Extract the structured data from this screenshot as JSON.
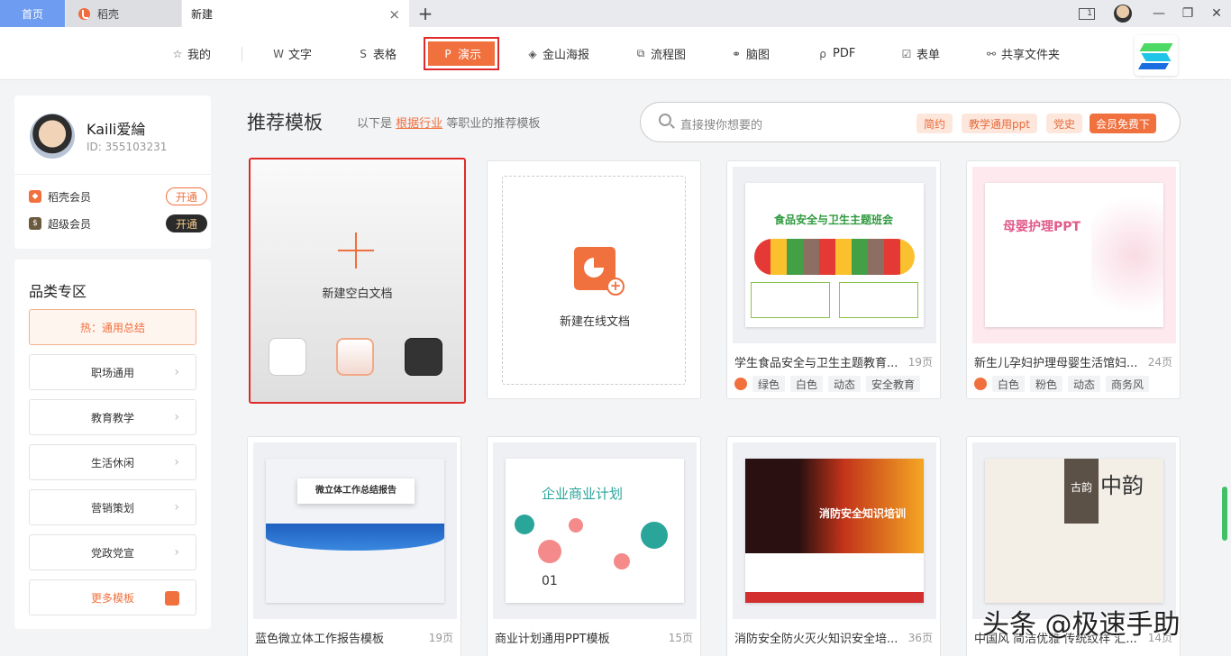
{
  "tabs": {
    "home": "首页",
    "daoke": "稻壳",
    "new": "新建",
    "close": "×",
    "plus": "+"
  },
  "window": {
    "box_label": "1",
    "minimize": "—",
    "restore": "❐",
    "close": "✕"
  },
  "toolbar": [
    {
      "label": "我的",
      "icon": "star-icon"
    },
    {
      "label": "文字",
      "icon": "w-icon"
    },
    {
      "label": "表格",
      "icon": "s-icon"
    },
    {
      "label": "演示",
      "icon": "p-icon"
    },
    {
      "label": "金山海报",
      "icon": "poster-icon"
    },
    {
      "label": "流程图",
      "icon": "flow-icon"
    },
    {
      "label": "脑图",
      "icon": "mindmap-icon"
    },
    {
      "label": "PDF",
      "icon": "pdf-icon"
    },
    {
      "label": "表单",
      "icon": "form-icon"
    },
    {
      "label": "共享文件夹",
      "icon": "share-icon"
    }
  ],
  "user": {
    "name": "Kaili爱綸",
    "id": "ID: 355103231",
    "vips": [
      {
        "label": "稻壳会员",
        "button": "开通"
      },
      {
        "label": "超级会员",
        "button": "开通"
      }
    ]
  },
  "categories": {
    "title": "品类专区",
    "items": [
      "热：通用总结",
      "职场通用",
      "教育教学",
      "生活休闲",
      "营销策划",
      "党政党宣",
      "更多模板"
    ]
  },
  "main": {
    "title": "推荐模板",
    "subtitle_pre": "以下是",
    "subtitle_link": "根据行业",
    "subtitle_post": "等职业的推荐模板"
  },
  "search": {
    "placeholder": "直接搜你想要的",
    "tags": [
      "简约",
      "教学通用ppt",
      "党史",
      "会员免费下"
    ]
  },
  "blank": {
    "label": "新建空白文档"
  },
  "online": {
    "label": "新建在线文档"
  },
  "templates": [
    {
      "name": "学生食品安全与卫生主题教育...",
      "pages": "19页",
      "tags": [
        "绿色",
        "白色",
        "动态",
        "安全教育"
      ],
      "slide_title": "食品安全与卫生主题班会",
      "colors": {
        "main": "#2e9a3e"
      }
    },
    {
      "name": "新生儿孕妇护理母婴生活馆妇...",
      "pages": "24页",
      "tags": [
        "白色",
        "粉色",
        "动态",
        "商务风"
      ],
      "slide_title": "母婴护理PPT",
      "colors": {
        "main": "#e05a8a"
      }
    },
    {
      "name": "蓝色微立体工作报告模板",
      "pages": "19页",
      "tags": [],
      "slide_title": "微立体工作总结报告",
      "colors": {
        "main": "#1f5fbf"
      }
    },
    {
      "name": "商业计划通用PPT模板",
      "pages": "15页",
      "tags": [],
      "slide_title": "企业商业计划",
      "slide_number": "01",
      "colors": {
        "main": "#2aa59a"
      }
    },
    {
      "name": "消防安全防火灭火知识安全培...",
      "pages": "36页",
      "tags": [],
      "slide_title": "消防安全知识培训",
      "colors": {
        "main": "#d32f2f"
      }
    },
    {
      "name": "中国风 简洁优雅 传统纹样 汇...",
      "pages": "14页",
      "tags": [],
      "slide_title": "中韵",
      "slide_block": "古韵",
      "colors": {
        "main": "#5b5146"
      }
    }
  ],
  "watermark": "头条 @极速手助"
}
